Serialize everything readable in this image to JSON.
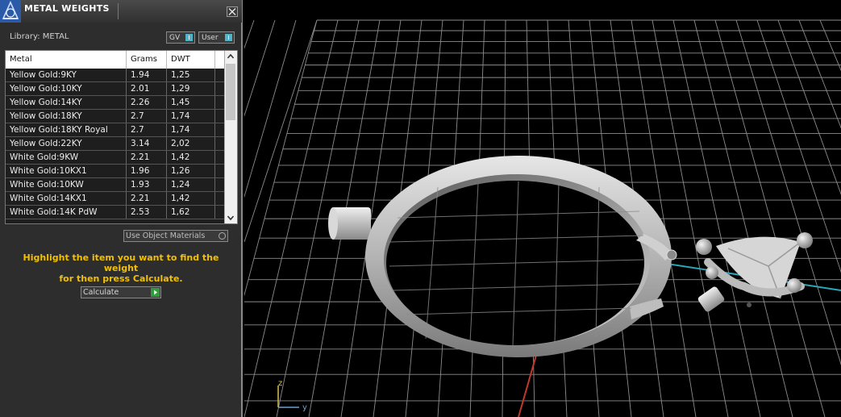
{
  "panel": {
    "title": "METAL WEIGHTS",
    "library_label": "Library: METAL",
    "toggles": [
      {
        "label": "GV",
        "state": "on"
      },
      {
        "label": "User",
        "state": "on"
      }
    ],
    "table": {
      "headers": [
        "Metal",
        "Grams",
        "DWT"
      ],
      "rows": [
        [
          "Yellow Gold:9KY",
          "1.94",
          "1,25"
        ],
        [
          "Yellow Gold:10KY",
          "2.01",
          "1,29"
        ],
        [
          "Yellow Gold:14KY",
          "2.26",
          "1,45"
        ],
        [
          "Yellow Gold:18KY",
          "2.7",
          "1,74"
        ],
        [
          "Yellow Gold:18KY Royal",
          "2.7",
          "1,74"
        ],
        [
          "Yellow Gold:22KY",
          "3.14",
          "2,02"
        ],
        [
          "White Gold:9KW",
          "2.21",
          "1,42"
        ],
        [
          "White Gold:10KX1",
          "1.96",
          "1,26"
        ],
        [
          "White Gold:10KW",
          "1.93",
          "1,24"
        ],
        [
          "White Gold:14KX1",
          "2.21",
          "1,42"
        ],
        [
          "White Gold:14K PdW",
          "2.53",
          "1,62"
        ]
      ]
    },
    "use_object_materials": "Use Object Materials",
    "hint_line1": "Highlight the item you want to find the weight",
    "hint_line2": "for then press Calculate.",
    "calculate_label": "Calculate"
  },
  "viewport": {
    "axis_labels": {
      "z": "z",
      "y": "y"
    },
    "colors": {
      "background": "#000000",
      "grid": "#8c8c8c",
      "x_axis": "#c0392b",
      "y_axis": "#2aa6b8",
      "model": "#c8c8c8",
      "hint_text": "#f2c000"
    },
    "icons": [
      "app-logo-icon",
      "close-icon",
      "scroll-up-icon",
      "scroll-down-icon",
      "play-icon"
    ]
  }
}
